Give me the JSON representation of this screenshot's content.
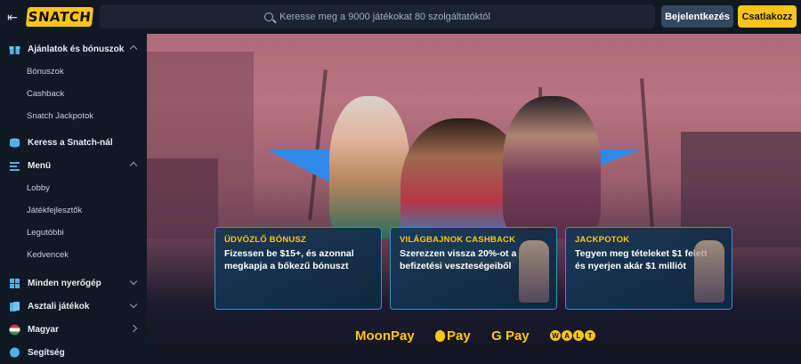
{
  "topbar": {
    "logo": "SNATCH",
    "search_placeholder": "Keresse meg a 9000 játékokat 80 szolgáltatóktól",
    "login_label": "Bejelentkezés",
    "join_label": "Csatlakozz"
  },
  "sidebar": {
    "offers": {
      "label": "Ajánlatok és bónuszok",
      "icon": "gift-icon",
      "items": [
        "Bónuszok",
        "Cashback",
        "Snatch Jackpotok"
      ]
    },
    "earn": {
      "label": "Keress a Snatch-nál",
      "icon": "coins-icon"
    },
    "menu": {
      "label": "Menü",
      "icon": "menu-list-icon",
      "items": [
        "Lobby",
        "Játékfejlesztők",
        "Legutóbbi",
        "Kedvencek"
      ]
    },
    "slots": {
      "label": "Minden nyerőgép",
      "icon": "grid-icon"
    },
    "tables": {
      "label": "Asztali játékok",
      "icon": "cards-icon"
    },
    "language": {
      "label": "Magyar",
      "icon": "hungary-flag-icon"
    },
    "help": {
      "label": "Segítség",
      "icon": "chat-icon"
    }
  },
  "cards": [
    {
      "title": "ÜDVÖZLŐ BÓNUSZ",
      "text": "Fizessen be $15+, és azonnal megkapja a bőkezű bónuszt"
    },
    {
      "title": "VILÁGBAJNOK CASHBACK",
      "text": "Szerezzen vissza 20%-ot a befizetési veszteségeiből"
    },
    {
      "title": "JACKPOTOK",
      "text": "Tegyen meg tételeket $1 felett és nyerjen akár $1 milliót"
    }
  ],
  "payments": {
    "moonpay": "MoonPay",
    "applepay": "Pay",
    "googlepay": "G Pay",
    "walt_letters": [
      "W",
      "A",
      "L",
      "T"
    ]
  },
  "colors": {
    "accent": "#ffc41a",
    "sidebar_bg": "#0f1823",
    "triangle": "#2f89e8"
  }
}
